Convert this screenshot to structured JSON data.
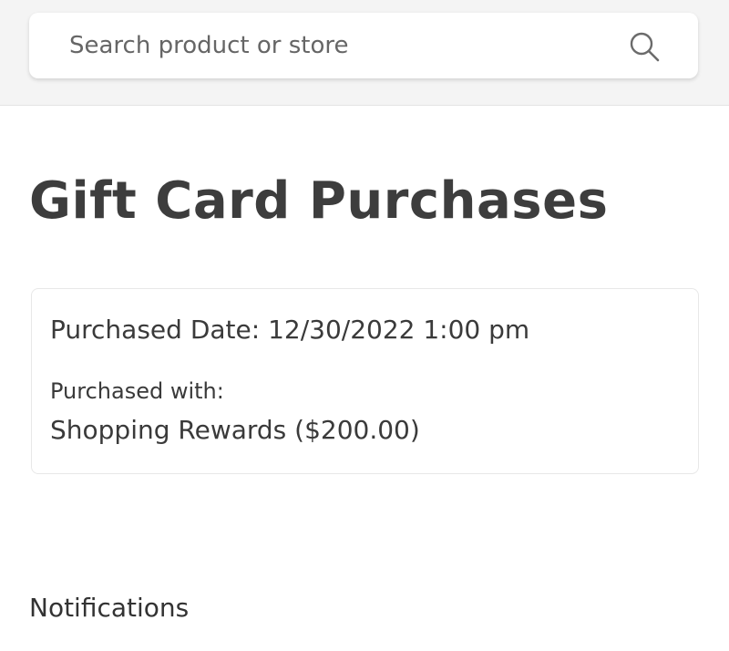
{
  "search": {
    "placeholder": "Search product or store",
    "icon": "search-icon"
  },
  "page": {
    "title": "Gift Card Purchases"
  },
  "purchase": {
    "date_text": "Purchased Date: 12/30/2022 1:00 pm",
    "with_label": "Purchased with:",
    "with_value": "Shopping Rewards ($200.00)"
  },
  "notifications": {
    "title": "Notifications"
  },
  "colors": {
    "header_bg": "#f4f4f4",
    "title_text": "#3d3d3d",
    "body_text": "#3a3a3a",
    "card_border": "#e8e8e8"
  }
}
